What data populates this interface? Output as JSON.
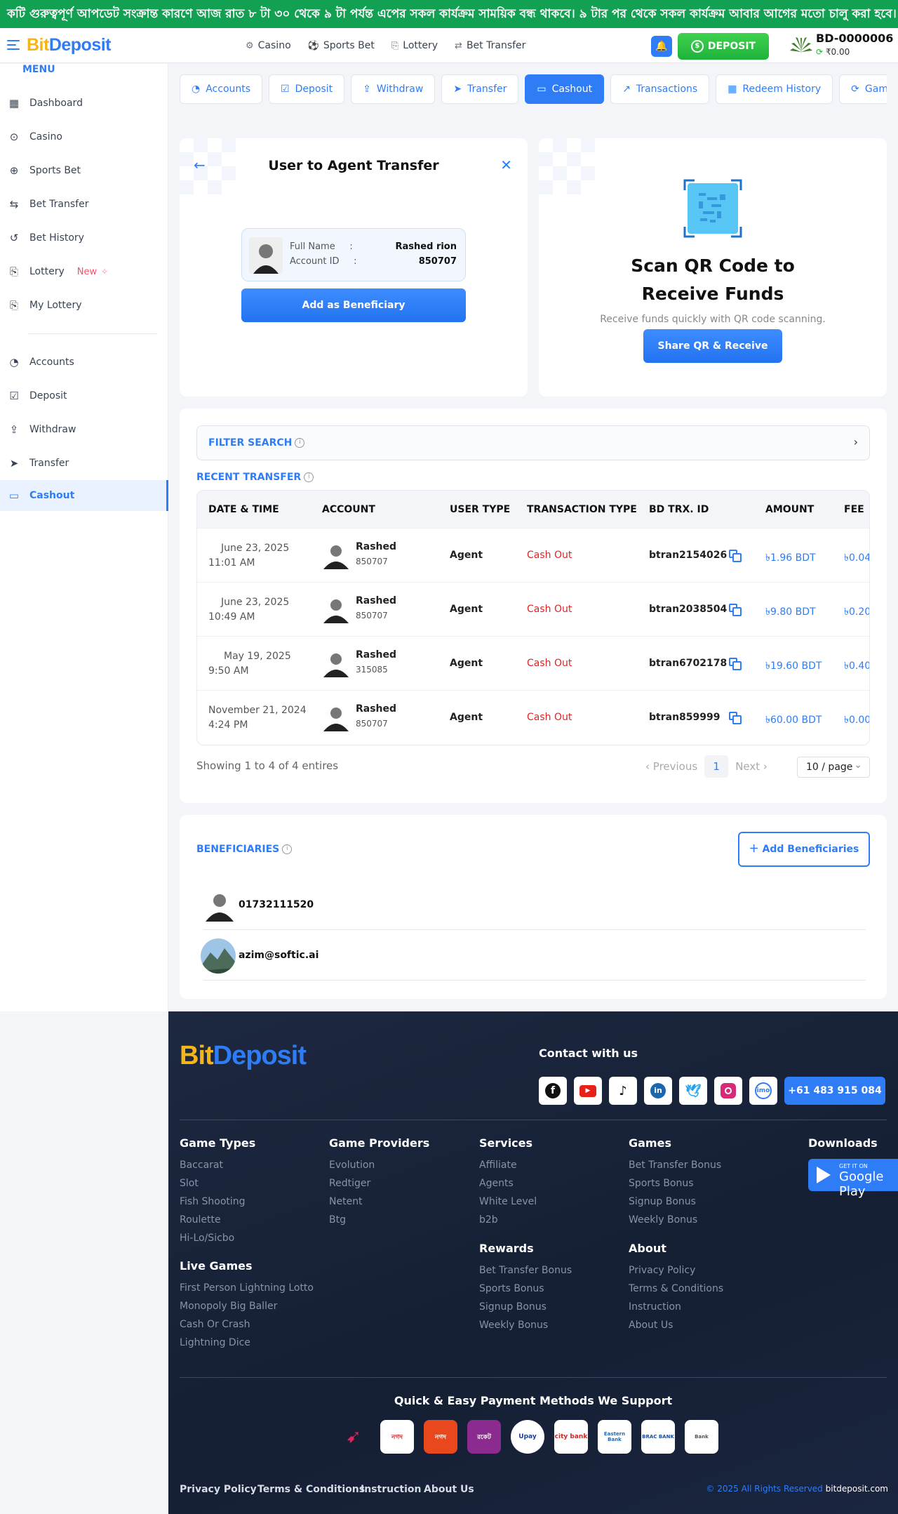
{
  "ticker": {
    "text": "কটি গুরুত্বপূর্ণ আপডেট সংক্রান্ত কারণে আজ রাত ৮ টা ৩০ থেকে ৯ টা পর্যন্ত এপের সকল কার্যক্রম সাময়িক বন্ধ থাকবে। ৯ টার পর থেকে সকল কার্যক্রম আবার আগের মতো চালু করা হবে। আমরা"
  },
  "header": {
    "logo_b": "Bit",
    "logo_d": "Deposit",
    "nav": [
      {
        "icon": "casino-icon",
        "label": "Casino"
      },
      {
        "icon": "sports-bet-icon",
        "label": "Sports Bet"
      },
      {
        "icon": "lottery-icon",
        "label": "Lottery"
      },
      {
        "icon": "bet-transfer-icon",
        "label": "Bet Transfer"
      }
    ],
    "deposit_label": "DEPOSIT",
    "account_id": "BD-0000006",
    "balance": "₹0.00"
  },
  "sidebar": {
    "menu_title": "MENU",
    "items": [
      {
        "label": "Dashboard",
        "icon": "dashboard-icon"
      },
      {
        "label": "Casino",
        "icon": "casino-icon"
      },
      {
        "label": "Sports Bet",
        "icon": "sports-bet-icon"
      },
      {
        "label": "Bet Transfer",
        "icon": "transfer-arrows-icon"
      },
      {
        "label": "Bet History",
        "icon": "history-icon"
      },
      {
        "label": "Lottery",
        "icon": "lottery-icon",
        "badge": "New"
      },
      {
        "label": "My Lottery",
        "icon": "lottery-icon"
      },
      {
        "label": "Accounts",
        "icon": "pie-chart-icon"
      },
      {
        "label": "Deposit",
        "icon": "deposit-icon"
      },
      {
        "label": "Withdraw",
        "icon": "withdraw-icon"
      },
      {
        "label": "Transfer",
        "icon": "send-icon"
      },
      {
        "label": "Cashout",
        "icon": "cash-icon",
        "active": true
      }
    ]
  },
  "tabs": [
    {
      "label": "Accounts",
      "icon": "◔"
    },
    {
      "label": "Deposit",
      "icon": "☑"
    },
    {
      "label": "Withdraw",
      "icon": "⇪"
    },
    {
      "label": "Transfer",
      "icon": "➤"
    },
    {
      "label": "Cashout",
      "icon": "▭",
      "active": true
    },
    {
      "label": "Transactions",
      "icon": "↗"
    },
    {
      "label": "Redeem History",
      "icon": "▦"
    },
    {
      "label": "Gam",
      "icon": "⟳"
    }
  ],
  "transfer": {
    "title": "User to Agent Transfer",
    "full_name_label": "Full Name",
    "full_name": "Rashed rion",
    "account_id_label": "Account ID",
    "account_id": "850707",
    "add_button": "Add as Beneficiary"
  },
  "qr": {
    "title": "Scan QR Code to Receive Funds",
    "subtitle": "Receive funds quickly with QR code scanning.",
    "button": "Share QR & Receive"
  },
  "transactions": {
    "filter_title": "FILTER SEARCH",
    "recent_title": "RECENT TRANSFER",
    "columns": [
      "DATE & TIME",
      "ACCOUNT",
      "USER TYPE",
      "TRANSACTION TYPE",
      "BD TRX. ID",
      "AMOUNT",
      "FEE"
    ],
    "rows": [
      {
        "date": "June 23, 2025",
        "time": "11:01 AM",
        "name": "Rashed",
        "acc": "850707",
        "user_type": "Agent",
        "tx_type": "Cash Out",
        "trx_id": "btran2154026",
        "amount": "৳1.96 BDT",
        "fee": "৳0.04"
      },
      {
        "date": "June 23, 2025",
        "time": "10:49 AM",
        "name": "Rashed",
        "acc": "850707",
        "user_type": "Agent",
        "tx_type": "Cash Out",
        "trx_id": "btran2038504",
        "amount": "৳9.80 BDT",
        "fee": "৳0.20"
      },
      {
        "date": "May 19, 2025",
        "time": "9:50 AM",
        "name": "Rashed",
        "acc": "315085",
        "user_type": "Agent",
        "tx_type": "Cash Out",
        "trx_id": "btran6702178",
        "amount": "৳19.60 BDT",
        "fee": "৳0.40"
      },
      {
        "date": "November 21, 2024",
        "time": "4:24 PM",
        "name": "Rashed",
        "acc": "850707",
        "user_type": "Agent",
        "tx_type": "Cash Out",
        "trx_id": "btran859999",
        "amount": "৳60.00 BDT",
        "fee": "৳0.00"
      }
    ],
    "showing": "Showing 1 to 4 of 4 entires",
    "prev": "Previous",
    "page": "1",
    "next": "Next",
    "page_size": "10 / page"
  },
  "beneficiaries": {
    "title": "BENEFICIARIES",
    "add_button": "Add Beneficiaries",
    "items": [
      {
        "name": "01732111520"
      },
      {
        "name": "azim@softic.ai"
      }
    ]
  },
  "footer": {
    "contact_title": "Contact with us",
    "phone": "+61 483 915 084",
    "socials": [
      "facebook-icon",
      "youtube-icon",
      "tiktok-icon",
      "linkedin-icon",
      "twitter-icon",
      "instagram-icon",
      "imo-icon"
    ],
    "cols": {
      "game_types": {
        "title": "Game Types",
        "links": [
          "Baccarat",
          "Slot",
          "Fish Shooting",
          "Roulette",
          "Hi-Lo/Sicbo"
        ]
      },
      "live_games": {
        "title": "Live Games",
        "links": [
          "First Person Lightning Lotto",
          "Monopoly Big Baller",
          "Cash Or Crash",
          "Lightning Dice"
        ]
      },
      "providers": {
        "title": "Game Providers",
        "links": [
          "Evolution",
          "Redtiger",
          "Netent",
          "Btg"
        ]
      },
      "services": {
        "title": "Services",
        "links": [
          "Affiliate",
          "Agents",
          "White Level",
          "b2b"
        ]
      },
      "rewards": {
        "title": "Rewards",
        "links": [
          "Bet Transfer Bonus",
          "Sports Bonus",
          "Signup Bonus",
          "Weekly Bonus"
        ]
      },
      "games": {
        "title": "Games",
        "links": [
          "Bet Transfer Bonus",
          "Sports Bonus",
          "Signup Bonus",
          "Weekly Bonus"
        ]
      },
      "about": {
        "title": "About",
        "links": [
          "Privacy Policy",
          "Terms & Conditions",
          "Instruction",
          "About Us"
        ]
      },
      "downloads": {
        "title": "Downloads",
        "get_it": "GET IT ON",
        "store": "Google Play"
      }
    },
    "payments_title": "Quick & Easy Payment Methods We Support",
    "payments": [
      "",
      "নগদ",
      "নগদ",
      "রকেট",
      "Upay",
      "city bank",
      "Eastern Bank",
      "BRAC BANK",
      "Bank"
    ],
    "bottom_links": [
      "Privacy Policy",
      "Terms & Conditions",
      "Instruction",
      "About Us"
    ],
    "copyright": "© 2025 All Rights Reserved",
    "domain": "bitdeposit.com"
  }
}
